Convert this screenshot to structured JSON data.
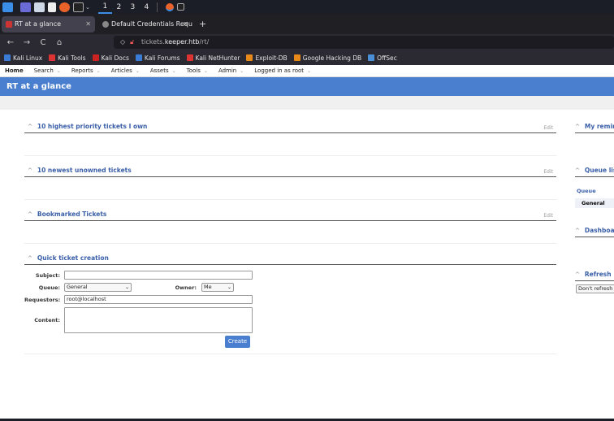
{
  "taskbar": {
    "workspaces": [
      "1",
      "2",
      "3",
      "4"
    ]
  },
  "tabs": [
    {
      "label": "RT at a glance",
      "active": true
    },
    {
      "label": "Default Credentials Requ",
      "active": false
    }
  ],
  "newtab": "+",
  "tab_close": "✕",
  "url": {
    "prefix": "tickets.",
    "domain": "keeper.htb",
    "suffix": "/rt/"
  },
  "nav": {
    "back": "←",
    "forward": "→",
    "reload": "C",
    "home": "⌂"
  },
  "bookmarks": [
    {
      "label": "Kali Linux",
      "color": "#3a7bd5"
    },
    {
      "label": "Kali Tools",
      "color": "#d33"
    },
    {
      "label": "Kali Docs",
      "color": "#c22"
    },
    {
      "label": "Kali Forums",
      "color": "#3a7bd5"
    },
    {
      "label": "Kali NetHunter",
      "color": "#d33"
    },
    {
      "label": "Exploit-DB",
      "color": "#e88a1a"
    },
    {
      "label": "Google Hacking DB",
      "color": "#e88a1a"
    },
    {
      "label": "OffSec",
      "color": "#4a90d9"
    }
  ],
  "menu": [
    {
      "label": "Home",
      "bold": true
    },
    {
      "label": "Search"
    },
    {
      "label": "Reports"
    },
    {
      "label": "Articles"
    },
    {
      "label": "Assets"
    },
    {
      "label": "Tools"
    },
    {
      "label": "Admin"
    },
    {
      "label": "Logged in as root"
    }
  ],
  "page_title": "RT at a glance",
  "portlets": {
    "priority": {
      "title": "10 highest priority tickets I own",
      "edit": "Edit"
    },
    "unowned": {
      "title": "10 newest unowned tickets",
      "edit": "Edit"
    },
    "bookmarked": {
      "title": "Bookmarked Tickets",
      "edit": "Edit"
    },
    "quick": {
      "title": "Quick ticket creation"
    }
  },
  "quick_form": {
    "subject_label": "Subject:",
    "subject_value": "",
    "queue_label": "Queue:",
    "queue_value": "General",
    "owner_label": "Owner:",
    "owner_value": "Me",
    "requestors_label": "Requestors:",
    "requestors_value": "root@localhost",
    "content_label": "Content:",
    "create_button": "Create"
  },
  "right": {
    "reminders": "My remin",
    "queue_list": "Queue lis",
    "queue_col": "Queue",
    "queue_row": "General",
    "dashboards": "Dashboa",
    "refresh": "Refresh",
    "refresh_select": "Don't refresh t"
  },
  "chevron": "^",
  "dropdown_arrow": "⌄"
}
